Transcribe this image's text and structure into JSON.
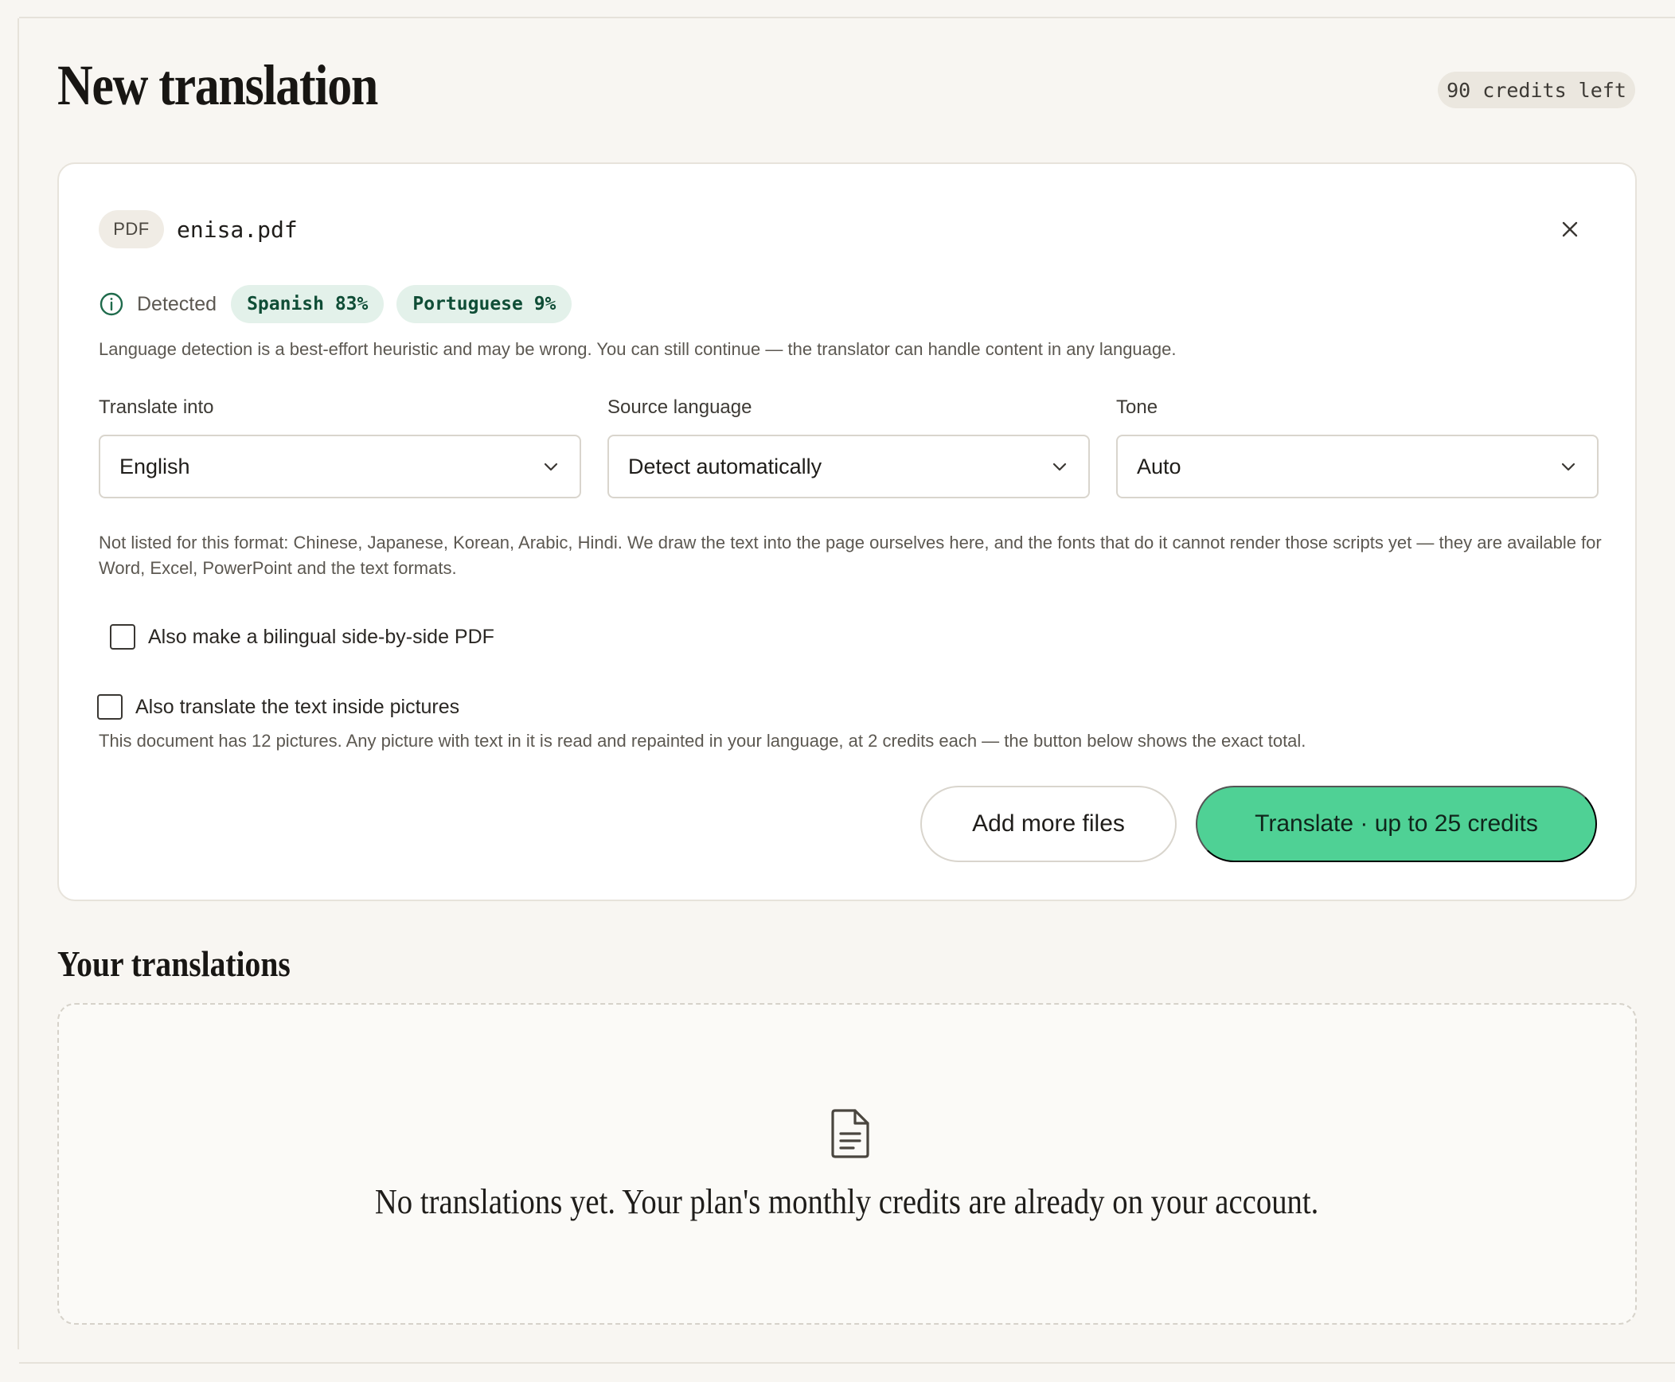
{
  "page": {
    "title": "New translation",
    "credits_left": "90 credits left"
  },
  "upload": {
    "file_type": "PDF",
    "file_name": "enisa.pdf",
    "detected_label": "Detected",
    "detected_languages": [
      {
        "label": "Spanish 83%"
      },
      {
        "label": "Portuguese 9%"
      }
    ],
    "detection_note": "Language detection is a best-effort heuristic and may be wrong. You can still continue — the translator can handle content in any language."
  },
  "fields": {
    "translate_into": {
      "label": "Translate into",
      "value": "English"
    },
    "source_language": {
      "label": "Source language",
      "value": "Detect automatically"
    },
    "tone": {
      "label": "Tone",
      "value": "Auto"
    }
  },
  "format_note": "Not listed for this format: Chinese, Japanese, Korean, Arabic, Hindi. We draw the text into the page ourselves here, and the fonts that do it cannot render those scripts yet — they are available for Word, Excel, PowerPoint and the text formats.",
  "options": {
    "bilingual": {
      "label": "Also make a bilingual side-by-side PDF",
      "checked": false
    },
    "pictures": {
      "label": "Also translate the text inside pictures",
      "checked": false
    },
    "pictures_note": "This document has 12 pictures. Any picture with text in it is read and repainted in your language, at 2 credits each — the button below shows the exact total."
  },
  "actions": {
    "add_files": "Add more files",
    "translate": "Translate · up to 25 credits"
  },
  "history": {
    "title": "Your translations",
    "empty_message": "No translations yet. Your plan's monthly credits are already on your account."
  },
  "colors": {
    "accent": "#4fd195",
    "chip_bg": "#e3f1ea",
    "chip_text": "#0f4d36",
    "background": "#f8f6f2"
  },
  "icons": {
    "info": "info-circle-icon",
    "close": "close-icon",
    "chevron": "chevron-down-icon",
    "document": "document-icon"
  }
}
